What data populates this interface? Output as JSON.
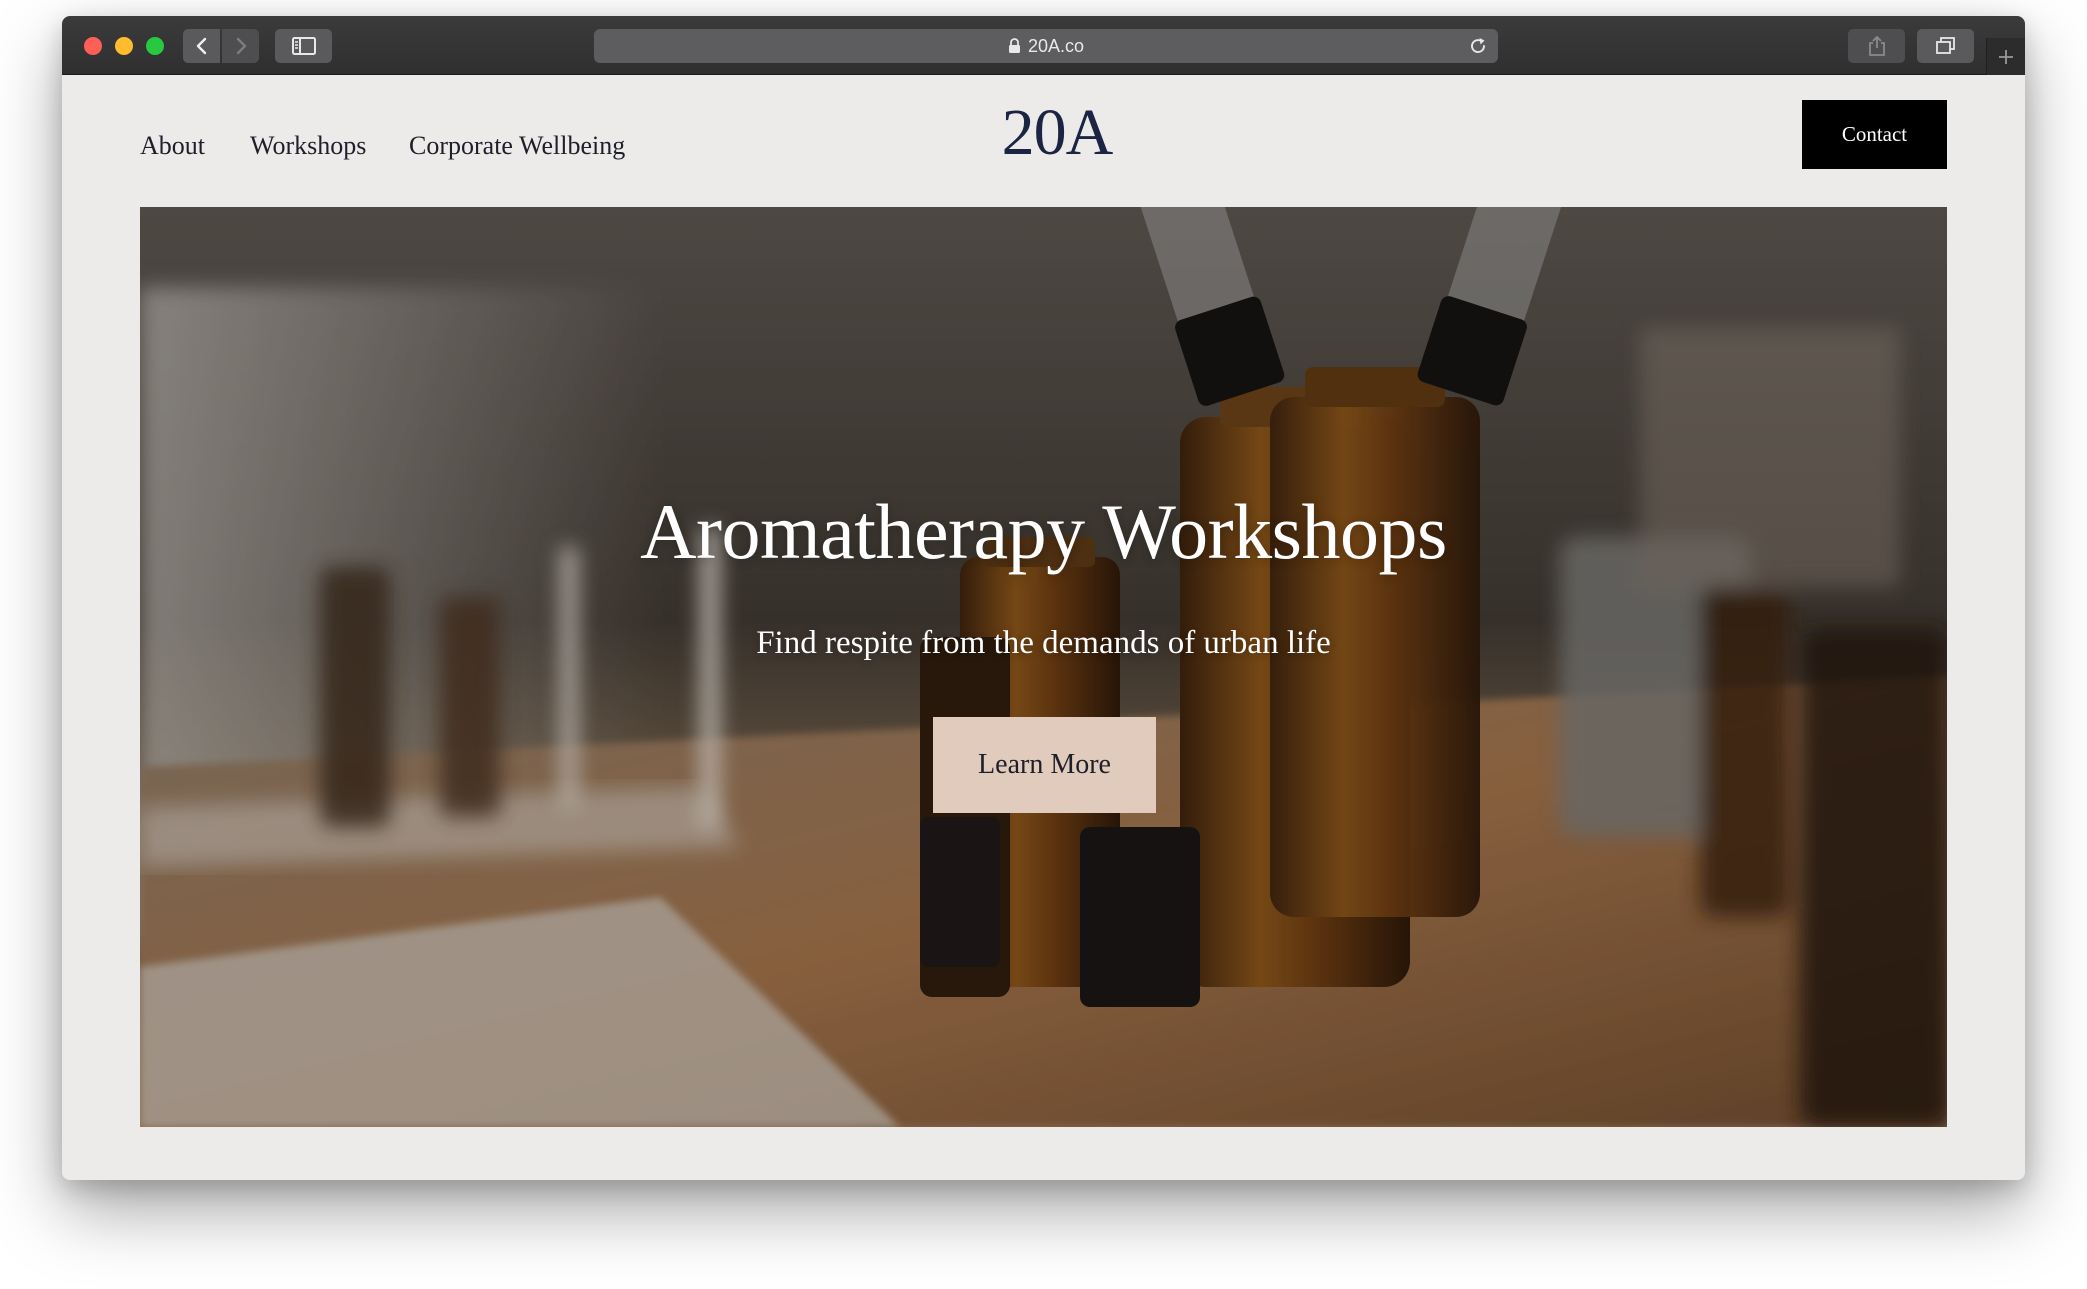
{
  "browser": {
    "url": "20A.co",
    "icons": {
      "back": "chevron-left-icon",
      "forward": "chevron-right-icon",
      "sidebar": "sidebar-icon",
      "lock": "lock-icon",
      "reload": "reload-icon",
      "share": "share-icon",
      "tabs": "tabs-overview-icon",
      "new_tab": "plus-icon"
    }
  },
  "nav": {
    "items": [
      {
        "label": "About"
      },
      {
        "label": "Workshops"
      },
      {
        "label": "Corporate Wellbeing"
      }
    ],
    "logo": "20A",
    "contact_label": "Contact"
  },
  "hero": {
    "title": "Aromatherapy Workshops",
    "subtitle": "Find respite from the demands of urban life",
    "cta_label": "Learn More",
    "background_image": "amber-glass-bottles-on-wooden-table",
    "colors": {
      "cta_background": "#e1cbbd",
      "text": "#ffffff"
    }
  },
  "colors": {
    "page_background": "#edebe9",
    "logo": "#1b2442",
    "contact_background": "#000000"
  }
}
